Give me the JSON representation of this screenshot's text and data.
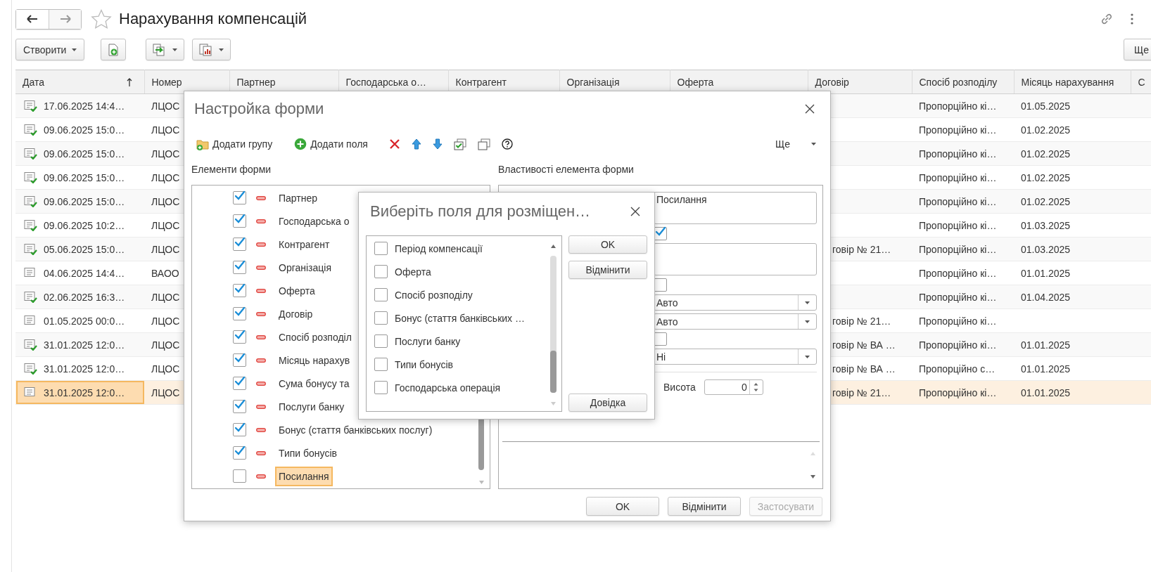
{
  "window": {
    "title": "Нарахування компенсацій"
  },
  "toolbar": {
    "create_button": "Створити",
    "more_button": "Ще"
  },
  "table": {
    "columns": [
      {
        "label": "Дата",
        "sorted_ascending": true
      },
      {
        "label": "Номер"
      },
      {
        "label": "Партнер"
      },
      {
        "label": "Господарська о…"
      },
      {
        "label": "Контрагент"
      },
      {
        "label": "Організація"
      },
      {
        "label": "Оферта"
      },
      {
        "label": "Договір"
      },
      {
        "label": "Спосіб розподілу"
      },
      {
        "label": "Місяць нарахування"
      },
      {
        "label": "С"
      }
    ],
    "rows": [
      {
        "posted": true,
        "date": "17.06.2025 14:4…",
        "number": "ЛЦОС",
        "method": "Пропорційно кі…",
        "month": "01.05.2025",
        "selected": false
      },
      {
        "posted": true,
        "date": "09.06.2025 15:0…",
        "number": "ЛЦОС",
        "method": "Пропорційно кі…",
        "month": "01.02.2025",
        "selected": false
      },
      {
        "posted": true,
        "date": "09.06.2025 15:0…",
        "number": "ЛЦОС",
        "method": "Пропорційно кі…",
        "month": "01.02.2025",
        "selected": false
      },
      {
        "posted": true,
        "date": "09.06.2025 15:0…",
        "number": "ЛЦОС",
        "method": "Пропорційно кі…",
        "month": "01.02.2025",
        "selected": false
      },
      {
        "posted": true,
        "date": "09.06.2025 15:0…",
        "number": "ЛЦОС",
        "method": "Пропорційно кі…",
        "month": "01.02.2025",
        "selected": false
      },
      {
        "posted": true,
        "date": "09.06.2025 10:2…",
        "number": "ЛЦОС",
        "method": "Пропорційно кі…",
        "month": "01.03.2025",
        "selected": false
      },
      {
        "posted": true,
        "date": "05.06.2025 15:0…",
        "number": "ЛЦОС",
        "contract": "говір № 21…",
        "method": "Пропорційно кі…",
        "month": "01.03.2025",
        "selected": false
      },
      {
        "posted": false,
        "date": "04.06.2025 14:4…",
        "number": "ВАОО",
        "method": "Пропорційно кі…",
        "month": "01.01.2025",
        "selected": false
      },
      {
        "posted": true,
        "date": "02.06.2025 16:3…",
        "number": "ЛЦОС",
        "method": "Пропорційно кі…",
        "month": "01.04.2025",
        "selected": false
      },
      {
        "posted": false,
        "date": "01.05.2025 00:0…",
        "number": "ЛЦОС",
        "contract": "говір № 21…",
        "method": "Пропорційно кі…",
        "selected": false
      },
      {
        "posted": true,
        "date": "31.01.2025 12:0…",
        "number": "ЛЦОС",
        "contract": "говір № ВА …",
        "method": "Пропорційно кі…",
        "month": "01.01.2025",
        "selected": false
      },
      {
        "posted": true,
        "date": "31.01.2025 12:0…",
        "number": "ЛЦОС",
        "contract": "говір № ВА …",
        "method": "Пропорційно с…",
        "month": "01.01.2025",
        "selected": false
      },
      {
        "posted": false,
        "date": "31.01.2025 12:0…",
        "number": "ЛЦОС",
        "contract": "говір № 21…",
        "method": "Пропорційно кі…",
        "month": "01.01.2025",
        "selected": true
      }
    ]
  },
  "form_settings_dialog": {
    "title": "Настройка форми",
    "toolbar": {
      "add_group": "Додати групу",
      "add_fields": "Додати поля",
      "more": "Ще"
    },
    "elements_label": "Елементи форми",
    "properties_label": "Властивості елемента форми",
    "elements": [
      {
        "label": "Партнер",
        "checked": true,
        "selected": false
      },
      {
        "label": "Господарська о",
        "checked": true,
        "selected": false
      },
      {
        "label": "Контрагент",
        "checked": true,
        "selected": false
      },
      {
        "label": "Організація",
        "checked": true,
        "selected": false
      },
      {
        "label": "Оферта",
        "checked": true,
        "selected": false
      },
      {
        "label": "Договір",
        "checked": true,
        "selected": false
      },
      {
        "label": "Спосіб розподіл",
        "checked": true,
        "selected": false
      },
      {
        "label": "Місяць нарахув",
        "checked": true,
        "selected": false
      },
      {
        "label": "Сума бонусу та",
        "checked": true,
        "selected": false
      },
      {
        "label": "Послуги банку",
        "checked": true,
        "selected": false
      },
      {
        "label": "Бонус (стаття банківських послуг)",
        "checked": true,
        "selected": false
      },
      {
        "label": "Типи бонусів",
        "checked": true,
        "selected": false
      },
      {
        "label": "Посилання",
        "checked": false,
        "selected": true
      }
    ],
    "properties": [
      {
        "kind": "text",
        "value": "Посилання"
      },
      {
        "kind": "checkbox",
        "checked": true
      },
      {
        "kind": "textarea"
      },
      {
        "kind": "checkbox",
        "checked": false
      },
      {
        "kind": "select",
        "value": "Авто"
      },
      {
        "kind": "select",
        "value": "Авто"
      },
      {
        "kind": "checkbox",
        "checked": false
      },
      {
        "kind": "select",
        "value": "Ні"
      },
      {
        "kind": "number",
        "label": "Висота",
        "value": "0"
      }
    ],
    "buttons": [
      {
        "label": "OK",
        "disabled": false
      },
      {
        "label": "Відмінити",
        "disabled": false
      },
      {
        "label": "Застосувати",
        "disabled": true
      }
    ]
  },
  "select_fields_dialog": {
    "title": "Виберіть поля для розміщен…",
    "fields": [
      {
        "label": "Період компенсації",
        "checked": false
      },
      {
        "label": "Оферта",
        "checked": false
      },
      {
        "label": "Спосіб розподілу",
        "checked": false
      },
      {
        "label": "Бонус (стаття банківських …",
        "checked": false
      },
      {
        "label": "Послуги банку",
        "checked": false
      },
      {
        "label": "Типи бонусів",
        "checked": false
      },
      {
        "label": "Господарська операція",
        "checked": false
      }
    ],
    "buttons": [
      "OK",
      "Відмінити",
      "Довідка"
    ]
  }
}
